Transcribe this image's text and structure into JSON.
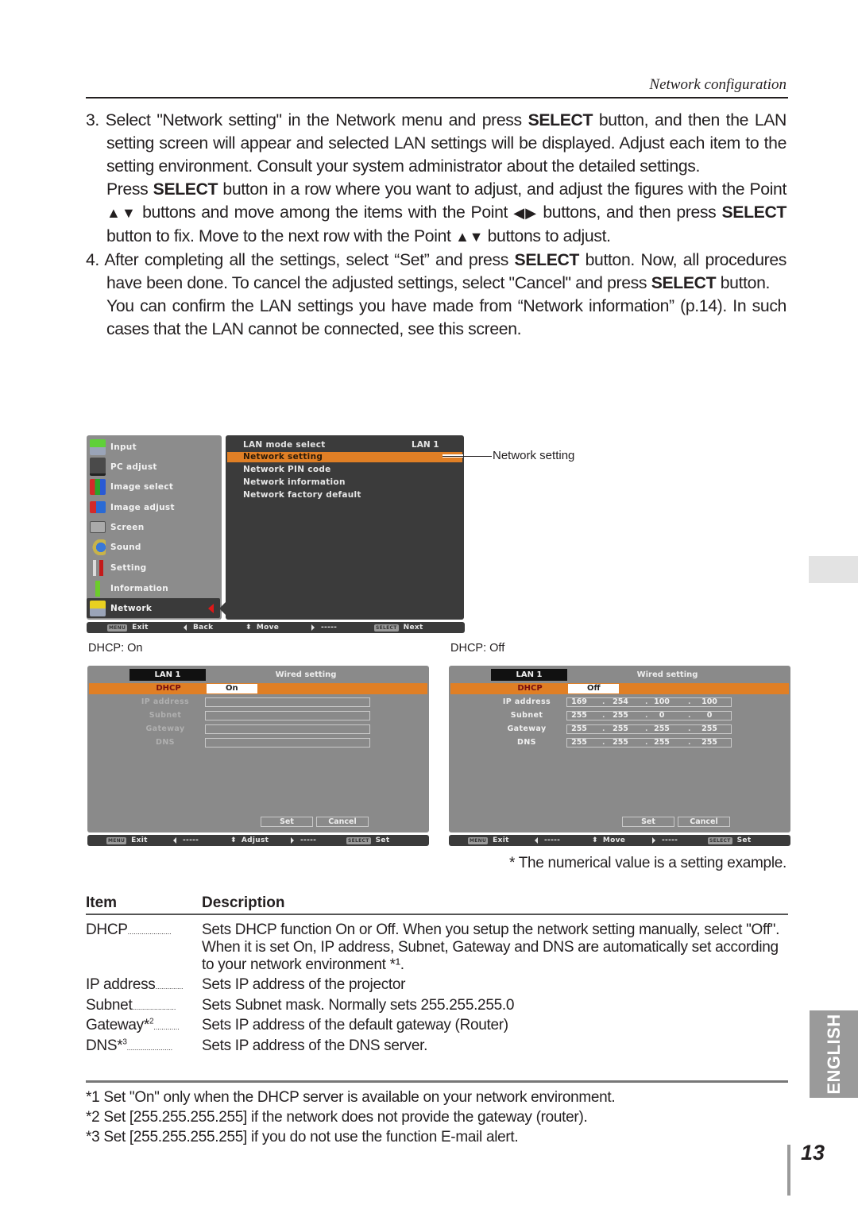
{
  "header": {
    "running_head": "Network configuration"
  },
  "body": {
    "step3_a": "3. Select \"Network setting\" in the Network menu and press ",
    "select_word": "SELECT",
    "step3_b": " button, and then the LAN setting screen will appear and selected LAN settings will be displayed. Adjust each item to the setting environment. Consult your system administrator about the detailed settings.",
    "para2_a": "Press ",
    "para2_b": " button in a row where you want to adjust, and adjust the figures with the Point ",
    "updown_glyph": "▲▼",
    "para2_c": " buttons and move among the items with the Point ",
    "leftright_glyph": "◀▶",
    "para2_d": " buttons, and then press ",
    "para2_e": " button to fix. Move to the next row with the Point ",
    "para2_f": " buttons to adjust.",
    "step4_a": "4. After completing all the settings, select “Set” and press ",
    "step4_b": " button. Now, all procedures have been done. To cancel the adjusted settings, select \"Cancel\" and press ",
    "step4_c": " button.",
    "para4": "You can confirm the LAN settings you have made from “Network information” (p.14). In such cases  that the LAN cannot be connected, see this screen."
  },
  "network_menu": {
    "left_items": [
      {
        "label": "Input",
        "icon": "input-icon"
      },
      {
        "label": "PC adjust",
        "icon": "pc-adjust-icon"
      },
      {
        "label": "Image select",
        "icon": "image-select-icon"
      },
      {
        "label": "Image adjust",
        "icon": "image-adjust-icon"
      },
      {
        "label": "Screen",
        "icon": "screen-icon"
      },
      {
        "label": "Sound",
        "icon": "sound-icon"
      },
      {
        "label": "Setting",
        "icon": "setting-icon"
      },
      {
        "label": "Information",
        "icon": "information-icon"
      },
      {
        "label": "Network",
        "icon": "network-icon",
        "active": true
      }
    ],
    "right_items": [
      {
        "label": "LAN mode select",
        "value": "LAN 1"
      },
      {
        "label": "Network setting",
        "selected": true
      },
      {
        "label": "Network PIN code"
      },
      {
        "label": "Network information"
      },
      {
        "label": "Network factory default"
      }
    ],
    "bar": {
      "exit_key": "MENU",
      "exit": "Exit",
      "back": "Back",
      "move": "Move",
      "right": "-----",
      "next_key": "SELECT",
      "next": "Next"
    },
    "callout": "Network setting"
  },
  "dhcp_on": {
    "caption": "DHCP: On",
    "lan_tab": "LAN 1",
    "title": "Wired setting",
    "dhcp_label": "DHCP",
    "dhcp_value": "On",
    "fields": [
      "IP address",
      "Subnet",
      "Gateway",
      "DNS"
    ],
    "set": "Set",
    "cancel": "Cancel",
    "bar": {
      "exit_key": "MENU",
      "exit": "Exit",
      "left": "-----",
      "adjust": "Adjust",
      "right": "-----",
      "set_key": "SELECT",
      "set": "Set"
    }
  },
  "dhcp_off": {
    "caption": "DHCP: Off",
    "lan_tab": "LAN 1",
    "title": "Wired setting",
    "dhcp_label": "DHCP",
    "dhcp_value": "Off",
    "fields": [
      {
        "label": "IP address",
        "octets": [
          "169",
          "254",
          "100",
          "100"
        ]
      },
      {
        "label": "Subnet",
        "octets": [
          "255",
          "255",
          "0",
          "0"
        ]
      },
      {
        "label": "Gateway",
        "octets": [
          "255",
          "255",
          "255",
          "255"
        ]
      },
      {
        "label": "DNS",
        "octets": [
          "255",
          "255",
          "255",
          "255"
        ]
      }
    ],
    "set": "Set",
    "cancel": "Cancel",
    "bar": {
      "exit_key": "MENU",
      "exit": "Exit",
      "left": "-----",
      "move": "Move",
      "right": "-----",
      "set_key": "SELECT",
      "set": "Set"
    }
  },
  "note": "* The numerical value is a setting example.",
  "table": {
    "headers": [
      "Item",
      "Description"
    ],
    "rows": [
      {
        "item": "DHCP",
        "sup": "",
        "dots": "......................",
        "desc": "Sets DHCP function On or Off. When you setup the network setting manually, select \"Off\". When it is set On, IP address, Subnet, Gateway  and DNS are automatically set according to your network environment *¹."
      },
      {
        "item": "IP address",
        "sup": "",
        "dots": "..............",
        "desc": "Sets IP address of the projector"
      },
      {
        "item": "Subnet",
        "sup": "",
        "dots": "......................",
        "desc": "Sets Subnet mask. Normally sets 255.255.255.0"
      },
      {
        "item": "Gateway*",
        "sup": "2",
        "dots": ".............",
        "desc": "Sets IP address of the default gateway (Router)"
      },
      {
        "item": "DNS*",
        "sup": "3",
        "dots": ".......................",
        "desc": "Sets IP address of the DNS server."
      }
    ]
  },
  "footnotes": [
    "*1 Set \"On\" only when the DHCP server is available on your network environment.",
    "*2 Set [255.255.255.255] if the network does not provide the gateway (router).",
    "*3 Set [255.255.255.255] if you do not use the function E-mail alert."
  ],
  "side": {
    "language_tab": "ENGLISH",
    "page_number": "13"
  },
  "colors": {
    "osd_orange": "#e07f25",
    "osd_dark": "#3b3b3b",
    "osd_grey": "#8a8a8a",
    "text": "#231f20"
  }
}
